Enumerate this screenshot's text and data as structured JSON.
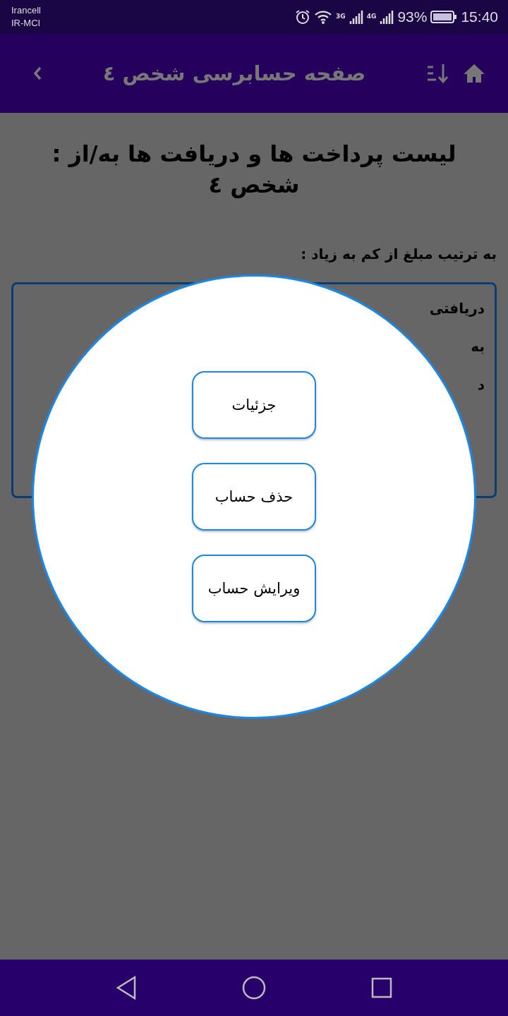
{
  "status_bar": {
    "carriers": [
      "Irancell",
      "IR-MCI"
    ],
    "network_3g": "3G",
    "network_4g": "4G",
    "battery": "93%",
    "time": "15:40"
  },
  "app_bar": {
    "title": "صفحه حسابرسی شخص ٤"
  },
  "heading": "لیست پرداخت ها و دریافت ها به/از : شخص ٤",
  "sort_label": "به ترتیب مبلغ از کم به زیاد :",
  "card": {
    "lines": [
      "دریافتی",
      "به",
      "د"
    ]
  },
  "menu": {
    "buttons": [
      {
        "label": "جزئیات"
      },
      {
        "label": "حذف حساب"
      },
      {
        "label": "ویرایش حساب"
      }
    ]
  }
}
